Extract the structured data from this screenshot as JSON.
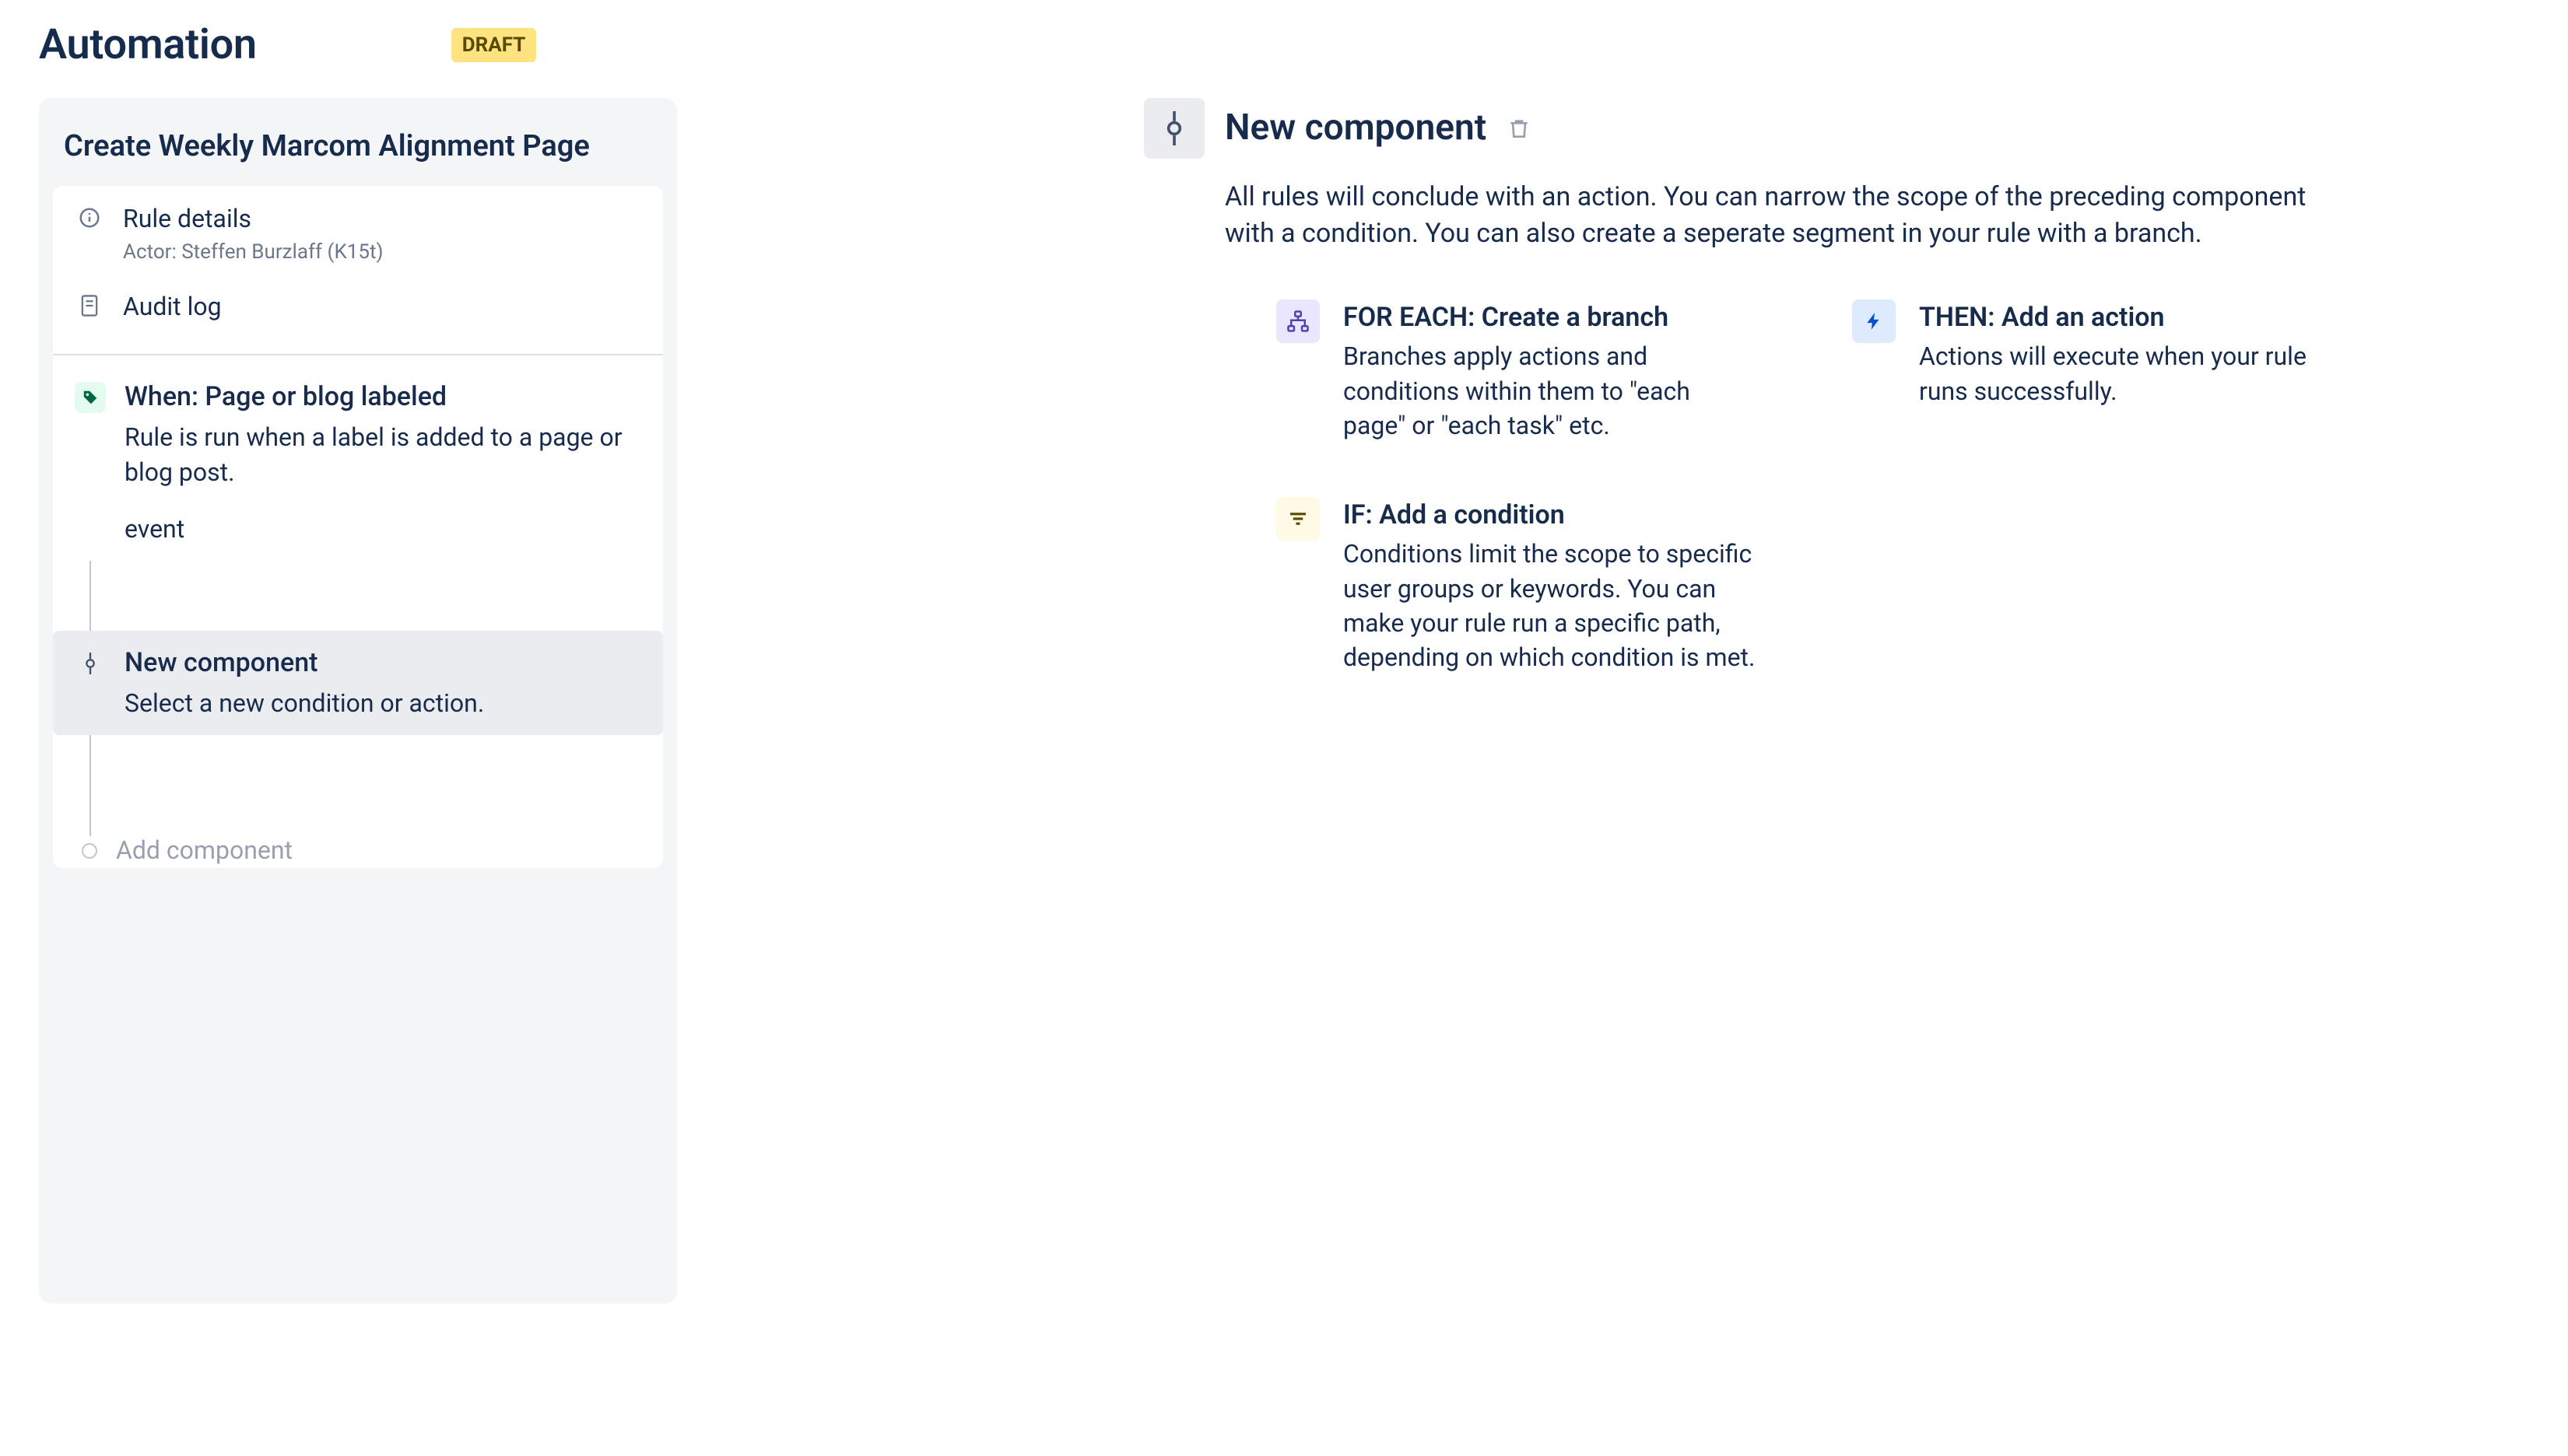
{
  "header": {
    "title": "Automation",
    "status": "DRAFT"
  },
  "sidebar": {
    "ruleName": "Create Weekly Marcom Alignment Page",
    "ruleDetailsLabel": "Rule details",
    "actorLabel": "Actor: Steffen Burzlaff (K15t)",
    "auditLogLabel": "Audit log",
    "trigger": {
      "title": "When: Page or blog labeled",
      "desc": "Rule is run when a label is added to a page or blog post.",
      "tag": "event"
    },
    "newComponent": {
      "title": "New component",
      "desc": "Select a new condition or action."
    },
    "addComponentLabel": "Add component"
  },
  "detail": {
    "title": "New component",
    "lead": "All rules will conclude with an action. You can narrow the scope of the preceding component with a condition. You can also create a seperate segment in your rule with a branch.",
    "options": {
      "forEach": {
        "title": "FOR EACH: Create a branch",
        "desc": "Branches apply actions and conditions within them to \"each page\" or \"each task\" etc."
      },
      "if": {
        "title": "IF: Add a condition",
        "desc": "Conditions limit the scope to specific user groups or keywords. You can make your rule run a specific path, depending on which condition is met."
      },
      "then": {
        "title": "THEN: Add an action",
        "desc": "Actions will execute when your rule runs successfully."
      }
    }
  }
}
